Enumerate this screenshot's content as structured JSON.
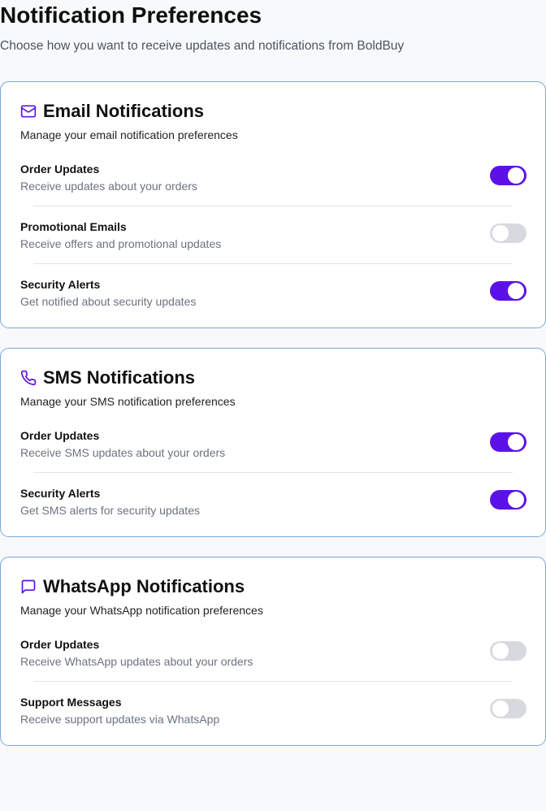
{
  "page": {
    "title": "Notification Preferences",
    "subtitle": "Choose how you want to receive updates and notifications from BoldBuy"
  },
  "colors": {
    "accent": "#5b12e6",
    "toggle_off": "#d7d9de",
    "card_border": "#7aa7e0"
  },
  "sections": [
    {
      "icon": "mail-icon",
      "title": "Email Notifications",
      "description": "Manage your email notification preferences",
      "items": [
        {
          "label": "Order Updates",
          "description": "Receive updates about your orders",
          "enabled": true
        },
        {
          "label": "Promotional Emails",
          "description": "Receive offers and promotional updates",
          "enabled": false
        },
        {
          "label": "Security Alerts",
          "description": "Get notified about security updates",
          "enabled": true
        }
      ]
    },
    {
      "icon": "phone-icon",
      "title": "SMS Notifications",
      "description": "Manage your SMS notification preferences",
      "items": [
        {
          "label": "Order Updates",
          "description": "Receive SMS updates about your orders",
          "enabled": true
        },
        {
          "label": "Security Alerts",
          "description": "Get SMS alerts for security updates",
          "enabled": true
        }
      ]
    },
    {
      "icon": "message-icon",
      "title": "WhatsApp Notifications",
      "description": "Manage your WhatsApp notification preferences",
      "items": [
        {
          "label": "Order Updates",
          "description": "Receive WhatsApp updates about your orders",
          "enabled": false
        },
        {
          "label": "Support Messages",
          "description": "Receive support updates via WhatsApp",
          "enabled": false
        }
      ]
    }
  ]
}
